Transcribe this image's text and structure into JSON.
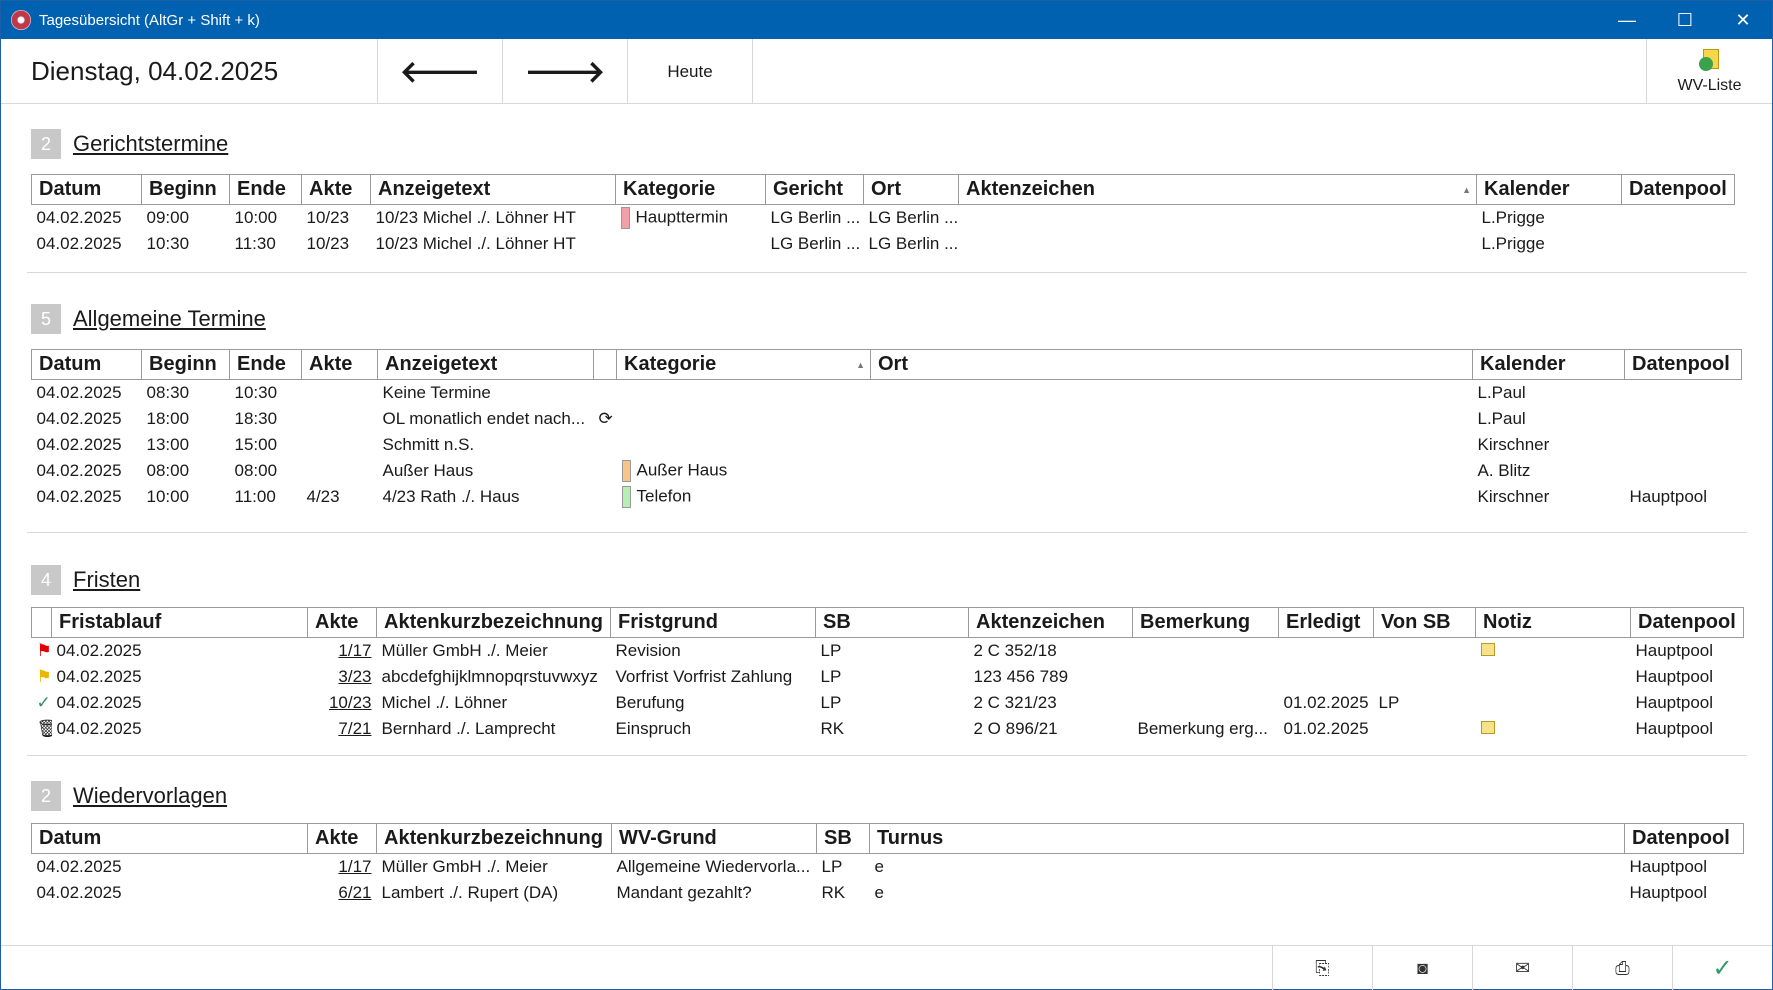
{
  "window": {
    "title": "Tagesübersicht (AltGr + Shift + k)"
  },
  "toolbar": {
    "date": "Dienstag, 04.02.2025",
    "prev": "🡐",
    "next": "🡒",
    "today": "Heute",
    "wv_list": "WV-Liste"
  },
  "gericht": {
    "count": "2",
    "title": "Gerichtstermine",
    "headers": [
      "Datum",
      "Beginn",
      "Ende",
      "Akte",
      "Anzeigetext",
      "Kategorie",
      "Gericht",
      "Ort",
      "Aktenzeichen",
      "Kalender",
      "Datenpool"
    ],
    "rows": [
      [
        "04.02.2025",
        "09:00",
        "10:00",
        "10/23",
        "10/23 Michel ./. Löhner HT",
        "Haupttermin",
        "LG Berlin ...",
        "LG Berlin ...",
        "",
        "L.Prigge",
        ""
      ],
      [
        "04.02.2025",
        "10:30",
        "11:30",
        "10/23",
        "10/23 Michel ./. Löhner HT",
        "",
        "LG Berlin ...",
        "LG Berlin ...",
        "",
        "L.Prigge",
        ""
      ]
    ]
  },
  "allgemein": {
    "count": "5",
    "title": "Allgemeine Termine",
    "headers": [
      "Datum",
      "Beginn",
      "Ende",
      "Akte",
      "Anzeigetext",
      "",
      "Kategorie",
      "Ort",
      "Kalender",
      "Datenpool"
    ],
    "rows": [
      [
        "04.02.2025",
        "08:30",
        "10:30",
        "",
        "Keine Termine",
        "",
        "",
        "",
        "L.Paul",
        ""
      ],
      [
        "04.02.2025",
        "18:00",
        "18:30",
        "",
        "OL monatlich endet nach...",
        "⟳",
        "",
        "",
        "L.Paul",
        ""
      ],
      [
        "04.02.2025",
        "13:00",
        "15:00",
        "",
        "Schmitt n.S.",
        "",
        "",
        "",
        "Kirschner",
        ""
      ],
      [
        "04.02.2025",
        "08:00",
        "08:00",
        "",
        "Außer Haus",
        "",
        "Außer Haus",
        "",
        "A. Blitz",
        ""
      ],
      [
        "04.02.2025",
        "10:00",
        "11:00",
        "4/23",
        "4/23 Rath ./. Haus",
        "",
        "Telefon",
        "",
        "Kirschner",
        "Hauptpool"
      ]
    ]
  },
  "fristen": {
    "count": "4",
    "title": "Fristen",
    "headers": [
      "",
      "Fristablauf",
      "Akte",
      "Aktenkurzbezeichnung",
      "Fristgrund",
      "SB",
      "Aktenzeichen",
      "Bemerkung",
      "Erledigt",
      "Von SB",
      "Notiz",
      "Datenpool"
    ],
    "rows": [
      [
        "⚑",
        "04.02.2025",
        "1/17",
        "Müller GmbH ./. Meier",
        "Revision",
        "LP",
        "2 C 352/18",
        "",
        "",
        "",
        "note",
        "Hauptpool"
      ],
      [
        "⚑",
        "04.02.2025",
        "3/23",
        "abcdefghijklmnopqrstuvwxyz",
        "Vorfrist Vorfrist Zahlung",
        "LP",
        "123 456 789",
        "",
        "",
        "",
        "",
        "Hauptpool"
      ],
      [
        "✓",
        "04.02.2025",
        "10/23",
        "Michel ./. Löhner",
        "Berufung",
        "LP",
        "2 C 321/23",
        "",
        "01.02.2025",
        "LP",
        "",
        "Hauptpool"
      ],
      [
        "🗑",
        "04.02.2025",
        "7/21",
        "Bernhard ./. Lamprecht",
        "Einspruch",
        "RK",
        "2 O 896/21",
        "Bemerkung erg...",
        "01.02.2025",
        "",
        "note",
        "Hauptpool"
      ]
    ]
  },
  "wieder": {
    "count": "2",
    "title": "Wiedervorlagen",
    "headers": [
      "Datum",
      "Akte",
      "Aktenkurzbezeichnung",
      "WV-Grund",
      "SB",
      "Turnus",
      "Datenpool"
    ],
    "rows": [
      [
        "04.02.2025",
        "1/17",
        "Müller GmbH ./. Meier",
        "Allgemeine Wiedervorla...",
        "LP",
        "e",
        "Hauptpool"
      ],
      [
        "04.02.2025",
        "6/21",
        "Lambert ./. Rupert (DA)",
        "Mandant gezahlt?",
        "RK",
        "e",
        "Hauptpool"
      ]
    ]
  },
  "colors": {
    "titlebar": "#0061b0",
    "haupttermin": "#f0a0a8",
    "ausserhaus": "#f8c48a",
    "telefon": "#b6efb6"
  }
}
